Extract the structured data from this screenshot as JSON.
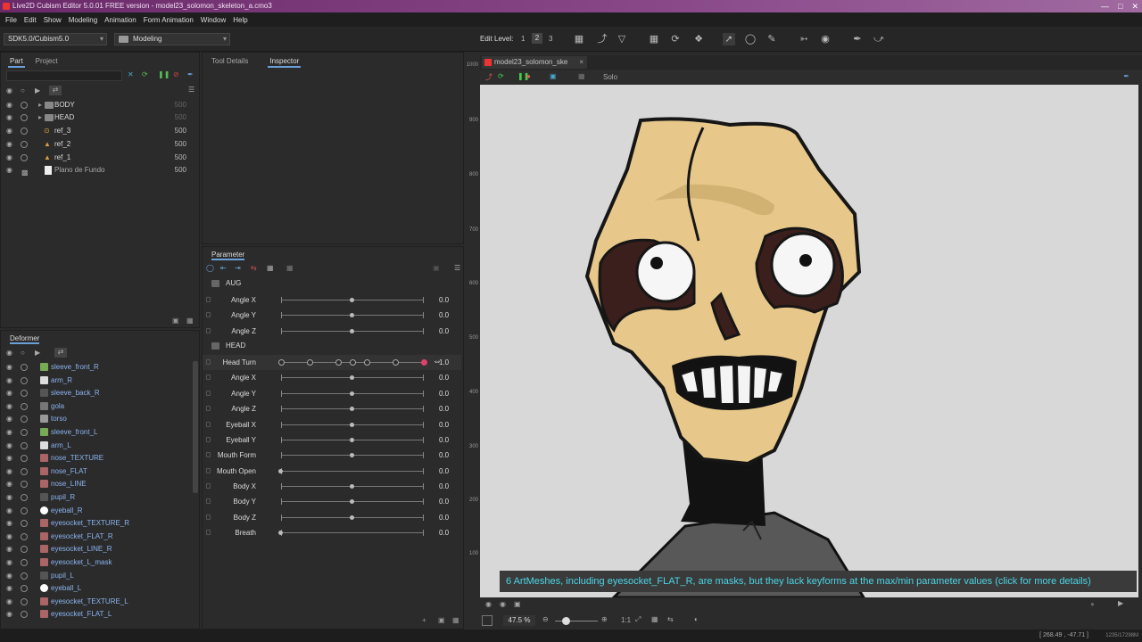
{
  "window": {
    "title": "Live2D Cubism Editor 5.0.01   FREE version   - model23_solomon_skeleton_a.cmo3",
    "controls": [
      "—",
      "□",
      "✕"
    ]
  },
  "menu": [
    "File",
    "Edit",
    "Show",
    "Modeling",
    "Animation",
    "Form Animation",
    "Window",
    "Help"
  ],
  "toolbar": {
    "sdk_select": "SDK5.0/Cubism5.0",
    "mode_select": "Modeling",
    "edit_level_label": "Edit Level:",
    "edit_levels": [
      "1",
      "2",
      "3"
    ]
  },
  "part_panel": {
    "tabs": [
      "Part",
      "Project"
    ],
    "rows": [
      {
        "name": "BODY",
        "value": "500",
        "type": "folder"
      },
      {
        "name": "HEAD",
        "value": "500",
        "type": "folder"
      },
      {
        "name": "ref_3",
        "value": "500",
        "type": "ref"
      },
      {
        "name": "ref_2",
        "value": "500",
        "type": "ref"
      },
      {
        "name": "ref_1",
        "value": "500",
        "type": "ref"
      },
      {
        "name": "Plano de Fundo",
        "value": "500",
        "type": "image"
      }
    ]
  },
  "deformer_panel": {
    "title": "Deformer",
    "rows": [
      "sleeve_front_R",
      "arm_R",
      "sleeve_back_R",
      "gola",
      "torso",
      "sleeve_front_L",
      "arm_L",
      "nose_TEXTURE",
      "nose_FLAT",
      "nose_LINE",
      "pupil_R",
      "eyeball_R",
      "eyesocket_TEXTURE_R",
      "eyesocket_FLAT_R",
      "eyesocket_LINE_R",
      "eyesocket_L_mask",
      "pupil_L",
      "eyeball_L",
      "eyesocket_TEXTURE_L",
      "eyesocket_FLAT_L"
    ]
  },
  "tool_panel": {
    "tabs": [
      "Tool Details",
      "Inspector"
    ]
  },
  "parameter_panel": {
    "title": "Parameter",
    "groups": [
      {
        "name": "AUG",
        "params": [
          {
            "label": "Angle X",
            "value": "0.0",
            "pos": 0.5
          },
          {
            "label": "Angle Y",
            "value": "0.0",
            "pos": 0.5
          },
          {
            "label": "Angle Z",
            "value": "0.0",
            "pos": 0.5
          }
        ]
      },
      {
        "name": "HEAD",
        "params": [
          {
            "label": "Head Turn",
            "value": "1.0",
            "pos": 1.0,
            "keyframes": true
          },
          {
            "label": "Angle X",
            "value": "0.0",
            "pos": 0.5
          },
          {
            "label": "Angle Y",
            "value": "0.0",
            "pos": 0.5
          },
          {
            "label": "Angle Z",
            "value": "0.0",
            "pos": 0.5
          },
          {
            "label": "Eyeball X",
            "value": "0.0",
            "pos": 0.5
          },
          {
            "label": "Eyeball Y",
            "value": "0.0",
            "pos": 0.5
          },
          {
            "label": "Mouth Form",
            "value": "0.0",
            "pos": 0.5
          },
          {
            "label": "Mouth Open",
            "value": "0.0",
            "pos": 0.0
          },
          {
            "label": "Body X",
            "value": "0.0",
            "pos": 0.5
          },
          {
            "label": "Body Y",
            "value": "0.0",
            "pos": 0.5
          },
          {
            "label": "Body Z",
            "value": "0.0",
            "pos": 0.5
          },
          {
            "label": "Breath",
            "value": "0.0",
            "pos": 0.0
          }
        ]
      }
    ]
  },
  "canvas": {
    "doc_tab": "model23_solomon_ske",
    "solo_label": "Solo",
    "ruler": [
      "1000",
      "900",
      "800",
      "700",
      "600",
      "500",
      "400",
      "300",
      "200",
      "100"
    ],
    "warning": "6 ArtMeshes, including eyesocket_FLAT_R, are masks, but they lack keyforms at the max/min parameter values (click for more details)",
    "zoom": "47.5 %",
    "ratio": "1:1"
  },
  "status": {
    "coords": "[ 268.49 , -47.71 ]",
    "size": "1235/17298M"
  },
  "colors": {
    "accent": "#6aa0d8",
    "warning_text": "#4bd6e6",
    "keyframe_active": "#e0406a"
  }
}
